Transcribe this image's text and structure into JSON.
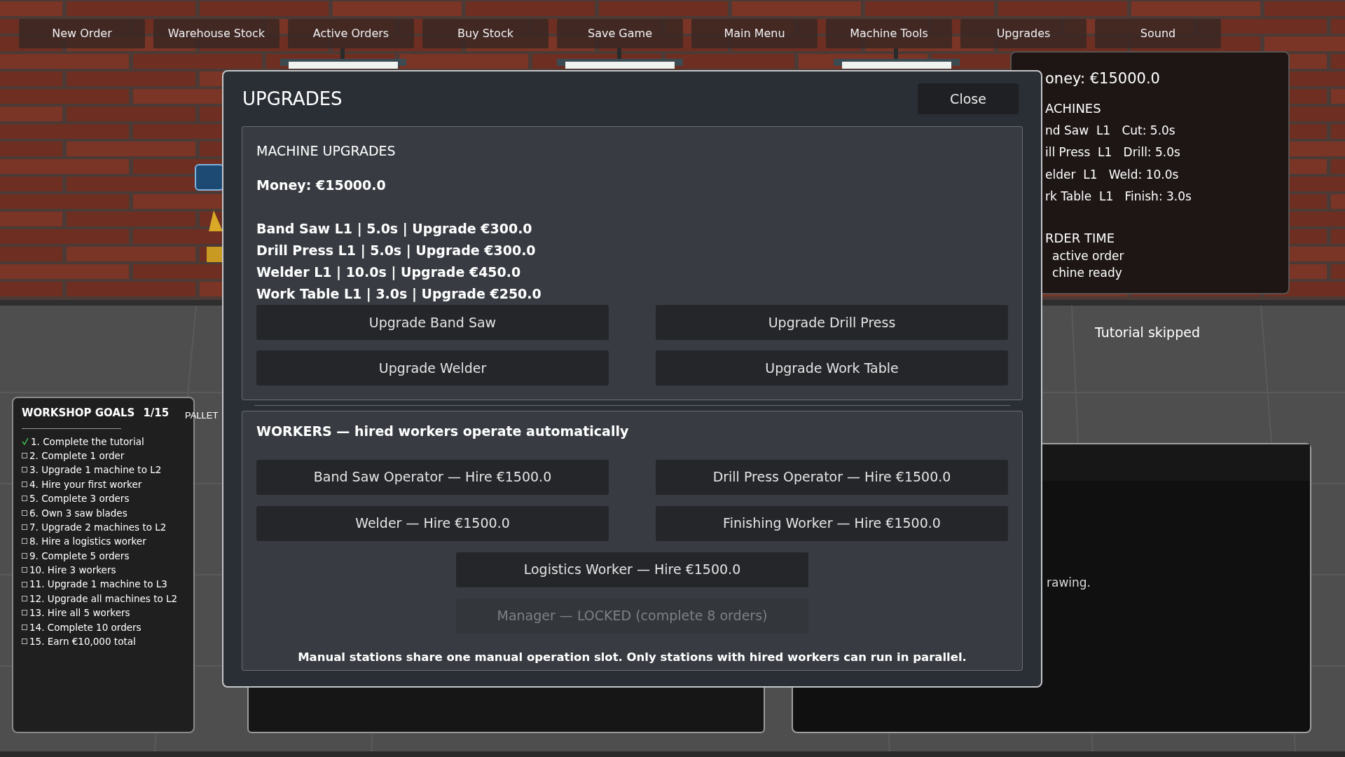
{
  "toolbar": [
    {
      "label": "New Order"
    },
    {
      "label": "Warehouse Stock"
    },
    {
      "label": "Active Orders"
    },
    {
      "label": "Buy Stock"
    },
    {
      "label": "Save Game"
    },
    {
      "label": "Main Menu"
    },
    {
      "label": "Machine Tools"
    },
    {
      "label": "Upgrades"
    },
    {
      "label": "Sound"
    }
  ],
  "info_panel": {
    "money": "oney: €15000.0",
    "machines_heading": "ACHINES",
    "machines": [
      {
        "name": "nd Saw",
        "level": "L1",
        "stat": "Cut: 5.0s"
      },
      {
        "name": "ill Press",
        "level": "L1",
        "stat": "Drill: 5.0s"
      },
      {
        "name": "elder",
        "level": "L1",
        "stat": "Weld: 10.0s"
      },
      {
        "name": "rk Table",
        "level": "L1",
        "stat": "Finish: 3.0s"
      }
    ],
    "order_heading": "RDER TIME",
    "order_lines": [
      "active order",
      "chine ready"
    ]
  },
  "status_text": "Tutorial skipped",
  "pallet_label": "PALLET",
  "goals": {
    "title": "WORKSHOP GOALS",
    "count": "1/15",
    "items": [
      {
        "label": "1. Complete the tutorial",
        "checked": true
      },
      {
        "label": "2. Complete 1 order",
        "checked": false
      },
      {
        "label": "3. Upgrade 1 machine to L2",
        "checked": false
      },
      {
        "label": "4. Hire your first worker",
        "checked": false
      },
      {
        "label": "5. Complete 3 orders",
        "checked": false
      },
      {
        "label": "6. Own 3 saw blades",
        "checked": false
      },
      {
        "label": "7. Upgrade 2 machines to L2",
        "checked": false
      },
      {
        "label": "8. Hire a logistics worker",
        "checked": false
      },
      {
        "label": "9. Complete 5 orders",
        "checked": false
      },
      {
        "label": "10. Hire 3 workers",
        "checked": false
      },
      {
        "label": "11. Upgrade 1 machine to L3",
        "checked": false
      },
      {
        "label": "12. Upgrade all machines to L2",
        "checked": false
      },
      {
        "label": "13. Hire all 5 workers",
        "checked": false
      },
      {
        "label": "14. Complete 10 orders",
        "checked": false
      },
      {
        "label": "15. Earn €10,000 total",
        "checked": false
      }
    ]
  },
  "drawing_panel": {
    "text": "rawing."
  },
  "upgrades_dialog": {
    "title": "UPGRADES",
    "close": "Close",
    "machine_section": {
      "heading": "MACHINE UPGRADES",
      "money": "Money: €15000.0",
      "machines": [
        "Band Saw L1 | 5.0s | Upgrade €300.0",
        "Drill Press L1 | 5.0s | Upgrade €300.0",
        "Welder L1 | 10.0s | Upgrade €450.0",
        "Work Table L1 | 3.0s | Upgrade €250.0"
      ],
      "buttons": [
        {
          "label": "Upgrade Band Saw"
        },
        {
          "label": "Upgrade Drill Press"
        },
        {
          "label": "Upgrade Welder"
        },
        {
          "label": "Upgrade Work Table"
        }
      ]
    },
    "workers_section": {
      "heading": "WORKERS — hired workers operate automatically",
      "hire_buttons": [
        {
          "label": "Band Saw Operator — Hire €1500.0",
          "disabled": false
        },
        {
          "label": "Drill Press Operator — Hire €1500.0",
          "disabled": false
        },
        {
          "label": "Welder — Hire €1500.0",
          "disabled": false
        },
        {
          "label": "Finishing Worker — Hire €1500.0",
          "disabled": false
        }
      ],
      "special_buttons": [
        {
          "label": "Logistics Worker — Hire €1500.0",
          "disabled": false
        },
        {
          "label": "Manager — LOCKED (complete 8 orders)",
          "disabled": true
        }
      ],
      "note": "Manual stations share one manual operation slot. Only stations with hired workers can run in parallel."
    }
  }
}
